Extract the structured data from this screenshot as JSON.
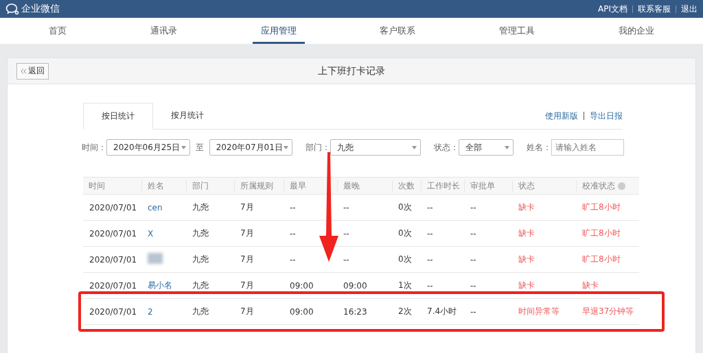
{
  "topbar": {
    "brand": "企业微信",
    "links": [
      "API文档",
      "联系客服",
      "退出"
    ]
  },
  "nav": [
    {
      "label": "首页",
      "selected": false
    },
    {
      "label": "通讯录",
      "selected": false
    },
    {
      "label": "应用管理",
      "selected": true
    },
    {
      "label": "客户联系",
      "selected": false
    },
    {
      "label": "管理工具",
      "selected": false
    },
    {
      "label": "我的企业",
      "selected": false
    }
  ],
  "panel": {
    "back": "返回",
    "title": "上下班打卡记录"
  },
  "tabs": [
    {
      "label": "按日统计",
      "selected": true
    },
    {
      "label": "按月统计",
      "selected": false
    }
  ],
  "links": [
    "使用新版",
    "导出日报"
  ],
  "filters": {
    "time_label": "时间：",
    "start": "2020年06月25日",
    "to": "至",
    "end": "2020年07月01日",
    "dept_label": "部门：",
    "dept": "九尧",
    "status_label": "状态：",
    "status": "全部",
    "name_label": "姓名：",
    "name_placeholder": "请输入姓名"
  },
  "table": {
    "columns": [
      "时间",
      "姓名",
      "部门",
      "所属规则",
      "最早",
      "最晚",
      "次数",
      "工作时长",
      "审批单",
      "状态",
      "校准状态"
    ],
    "rows": [
      {
        "date": "2020/07/01",
        "name": "cen",
        "name_hidden": false,
        "dept": "九尧",
        "rule": "7月",
        "earliest": "--",
        "latest": "--",
        "count": "0次",
        "hours": "--",
        "approval": "--",
        "status": "缺卡",
        "calibrated": "旷工8小时",
        "highlighted": false
      },
      {
        "date": "2020/07/01",
        "name": "X",
        "name_hidden": false,
        "dept": "九尧",
        "rule": "7月",
        "earliest": "--",
        "latest": "--",
        "count": "0次",
        "hours": "--",
        "approval": "--",
        "status": "缺卡",
        "calibrated": "旷工8小时",
        "highlighted": false
      },
      {
        "date": "2020/07/01",
        "name_hidden": true,
        "dept": "九尧",
        "rule": "7月",
        "earliest": "--",
        "latest": "--",
        "count": "0次",
        "hours": "--",
        "approval": "--",
        "status": "缺卡",
        "calibrated": "旷工8小时",
        "highlighted": false
      },
      {
        "date": "2020/07/01",
        "name": "易小名",
        "name_hidden": false,
        "dept": "九尧",
        "rule": "7月",
        "earliest": "09:00",
        "latest": "09:00",
        "count": "1次",
        "hours": "--",
        "approval": "--",
        "status": "缺卡",
        "calibrated": "缺卡",
        "highlighted": false
      },
      {
        "date": "2020/07/01",
        "name": "2",
        "name_hidden": false,
        "dept": "九尧",
        "rule": "7月",
        "earliest": "09:00",
        "latest": "16:23",
        "count": "2次",
        "hours": "7.4小时",
        "approval": "--",
        "status": "时间异常等",
        "calibrated": "早退37分钟等",
        "highlighted": true
      }
    ]
  }
}
